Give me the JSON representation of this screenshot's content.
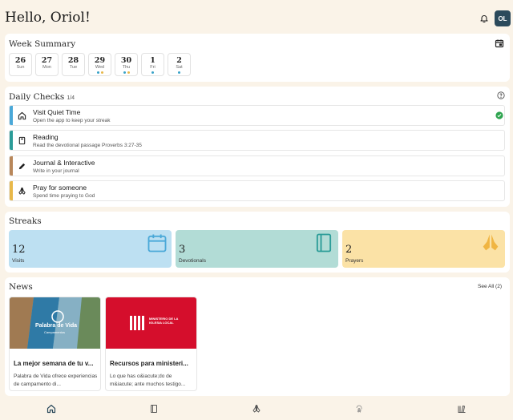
{
  "header": {
    "greeting": "Hello, Oriol!",
    "avatar_initials": "OL"
  },
  "week": {
    "title": "Week Summary",
    "days": [
      {
        "num": "26",
        "name": "Sun",
        "dots": []
      },
      {
        "num": "27",
        "name": "Mon",
        "dots": []
      },
      {
        "num": "28",
        "name": "Tue",
        "dots": []
      },
      {
        "num": "29",
        "name": "Wed",
        "dots": [
          "#3aa3c9",
          "#e8b84a"
        ]
      },
      {
        "num": "30",
        "name": "Thu",
        "dots": [
          "#3aa3c9",
          "#e8b84a"
        ]
      },
      {
        "num": "1",
        "name": "Fri",
        "dots": [
          "#3aa3c9"
        ]
      },
      {
        "num": "2",
        "name": "Sat",
        "dots": [
          "#3aa3c9"
        ]
      }
    ]
  },
  "checks": {
    "title": "Daily Checks",
    "count": "1/4",
    "items": [
      {
        "title": "Visit Quiet Time",
        "subtitle": "Open the app to keep your streak",
        "color": "#4aa8d8",
        "icon": "home-icon",
        "done": true
      },
      {
        "title": "Reading",
        "subtitle": "Read the devotional passage Proverbs 3:27-35",
        "color": "#2b9c98",
        "icon": "book-icon",
        "done": false
      },
      {
        "title": "Journal & Interactive",
        "subtitle": "Write in your journal",
        "color": "#b8875a",
        "icon": "pencil-icon",
        "done": false
      },
      {
        "title": "Pray for someone",
        "subtitle": "Spend time praying to God",
        "color": "#e8b84a",
        "icon": "praying-hands-icon",
        "done": false
      }
    ]
  },
  "streaks": {
    "title": "Streaks",
    "items": [
      {
        "value": "12",
        "label": "Visits",
        "bg": "#bde0f2",
        "icon": "calendar-icon"
      },
      {
        "value": "3",
        "label": "Devotionals",
        "bg": "#b2dcd6",
        "icon": "book-icon"
      },
      {
        "value": "2",
        "label": "Prayers",
        "bg": "#fbe2a6",
        "icon": "praying-hands-icon"
      }
    ]
  },
  "news": {
    "title": "News",
    "see_all": "See All (2)",
    "items": [
      {
        "title": "La mejor semana de tu v...",
        "desc": "Palabra de Vida ofrece experiencias de campamento di...",
        "img_logo": "Palabra de Vida",
        "img_sub": "Campamentos"
      },
      {
        "title": "Recursos para ministeri...",
        "desc": "Lo que has o&iacute;do de m&iacute; ante muchos testigo...",
        "img_logo": "MINISTERIO DE LA IGLESIA LOCAL",
        "img_sub": ""
      }
    ]
  },
  "tabs": [
    "home-icon",
    "book-icon",
    "praying-hands-icon",
    "fingerprint-icon",
    "library-icon"
  ]
}
